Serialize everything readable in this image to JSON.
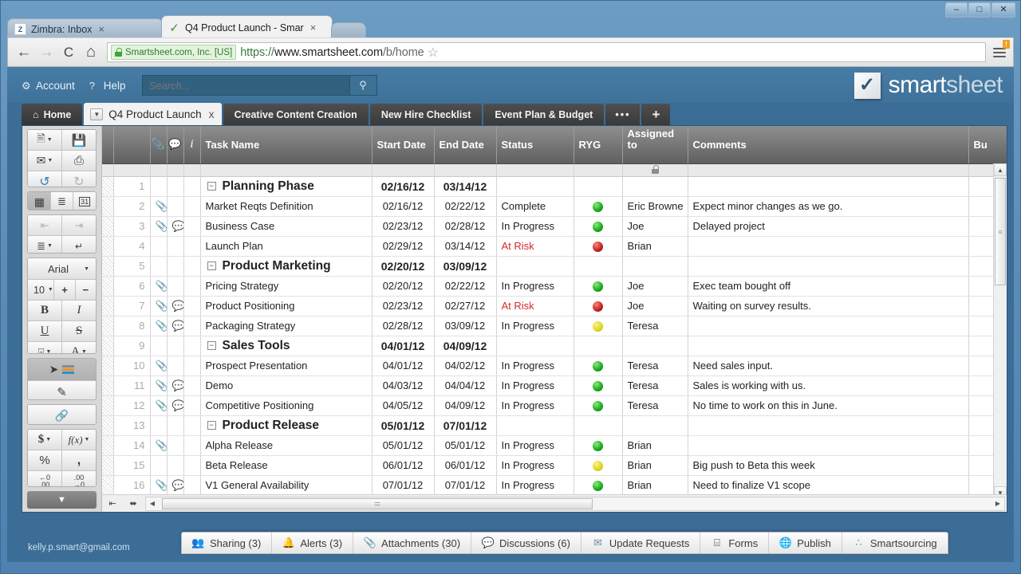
{
  "browser": {
    "window_buttons": {
      "minimize": "–",
      "maximize": "□",
      "close": "✕"
    },
    "tabs": [
      {
        "title": "Zimbra: Inbox",
        "favicon": "zimbra-icon",
        "favicon_text": "Z",
        "active": false,
        "close": "×"
      },
      {
        "title": "Q4 Product Launch - Smar",
        "favicon": "checkmark-icon",
        "favicon_text": "✓",
        "active": true,
        "close": "×"
      }
    ],
    "nav": {
      "back": "←",
      "forward": "→",
      "reload": "C",
      "home": "⌂"
    },
    "security_label": "Smartsheet.com, Inc. [US]",
    "url_scheme": "https://",
    "url_host": "www.smartsheet.com",
    "url_path": "/b/home",
    "bookmark_star": "☆",
    "menu_badge": "!"
  },
  "app_header": {
    "account_label": "Account",
    "help_label": "Help",
    "help_icon_text": "?",
    "search_placeholder": "Search...",
    "search_value": "",
    "search_icon": "⚲",
    "logo_check": "✓",
    "logo_word1": "smart",
    "logo_word2": "sheet"
  },
  "sheet_tabs": {
    "home_label": "Home",
    "home_icon": "⌂",
    "items": [
      {
        "label": "Q4 Product Launch",
        "active": true,
        "caret": "▼",
        "close": "x"
      },
      {
        "label": "Creative Content Creation",
        "active": false
      },
      {
        "label": "New Hire Checklist",
        "active": false
      },
      {
        "label": "Event Plan & Budget",
        "active": false
      }
    ],
    "more_label": "•••",
    "add_label": "+"
  },
  "toolbar": {
    "groups": [
      {
        "rows": [
          [
            {
              "name": "new-row-button",
              "glyph": "⬜",
              "caret": true
            },
            {
              "name": "save-button",
              "glyph": "💾"
            }
          ],
          [
            {
              "name": "send-email-button",
              "glyph": "✉",
              "caret": true
            },
            {
              "name": "print-button",
              "glyph": "⎙"
            }
          ],
          [
            {
              "name": "undo-button",
              "glyph": "↺"
            },
            {
              "name": "redo-button",
              "glyph": "↻",
              "dim": true
            }
          ]
        ]
      },
      {
        "rows": [
          [
            {
              "name": "grid-view-button",
              "glyph": "∷",
              "pressed": true
            },
            {
              "name": "gantt-view-button",
              "glyph": "≡"
            },
            {
              "name": "calendar-view-button",
              "glyph": "31"
            }
          ]
        ]
      },
      {
        "rows": [
          [
            {
              "name": "outdent-button",
              "glyph": "⇤",
              "dim": true
            },
            {
              "name": "indent-button",
              "glyph": "⇥",
              "dim": true
            }
          ],
          [
            {
              "name": "align-button",
              "glyph": "≡",
              "caret": true
            },
            {
              "name": "wrap-text-button",
              "glyph": "↵"
            }
          ]
        ]
      },
      {
        "rows": [
          [
            {
              "name": "font-family-select",
              "font": true,
              "label": "Arial",
              "caret": true
            }
          ],
          [
            {
              "name": "font-size-select",
              "size": true,
              "label": "10",
              "caret": true
            },
            {
              "name": "increase-font-button",
              "glyph": "＋"
            },
            {
              "name": "decrease-font-button",
              "glyph": "－"
            }
          ],
          [
            {
              "name": "bold-button",
              "glyph": "B",
              "cls": "bb"
            },
            {
              "name": "italic-button",
              "glyph": "I",
              "cls": "ii"
            }
          ],
          [
            {
              "name": "underline-button",
              "glyph": "U",
              "cls": "uu"
            },
            {
              "name": "strikethrough-button",
              "glyph": "S",
              "cls": "ss"
            }
          ],
          [
            {
              "name": "fill-color-button",
              "glyph": "🖌",
              "caret": true,
              "swatch": "#f6ef72"
            },
            {
              "name": "font-color-button",
              "glyph": "A",
              "caret": true,
              "swatch": "#cc2222"
            }
          ]
        ]
      },
      {
        "rows": [
          [
            {
              "name": "conditional-formatting-button",
              "glyph": "◈",
              "bars": true,
              "pressed": true
            }
          ],
          [
            {
              "name": "highlight-button",
              "glyph": "✎"
            }
          ]
        ]
      },
      {
        "rows": [
          [
            {
              "name": "hyperlink-button",
              "glyph": "🔗"
            }
          ]
        ]
      },
      {
        "rows": [
          [
            {
              "name": "currency-button",
              "glyph": "$",
              "cls": "dollar",
              "caret": true
            },
            {
              "name": "formula-button",
              "glyph": "f(x)",
              "cls": "fx",
              "caret": true
            }
          ],
          [
            {
              "name": "percent-button",
              "glyph": "%"
            },
            {
              "name": "thousands-separator-button",
              "glyph": ","
            }
          ],
          [
            {
              "name": "decrease-decimal-button",
              "glyph": "←0\n.00",
              "dec": true,
              "line1": "←0",
              "line2": ".00"
            },
            {
              "name": "increase-decimal-button",
              "glyph": ".00→0",
              "dec": true,
              "line1": ".00",
              "line2": "→0"
            }
          ]
        ]
      }
    ],
    "collapse_toolbar_label": "▼"
  },
  "grid": {
    "columns": [
      {
        "key": "hatch",
        "label": ""
      },
      {
        "key": "rownum",
        "label": ""
      },
      {
        "key": "attach",
        "label": "📎",
        "icon": true
      },
      {
        "key": "comment",
        "label": "💬",
        "icon": true
      },
      {
        "key": "info",
        "label": "i",
        "icon": true
      },
      {
        "key": "task",
        "label": "Task Name"
      },
      {
        "key": "start",
        "label": "Start Date"
      },
      {
        "key": "end",
        "label": "End Date"
      },
      {
        "key": "status",
        "label": "Status"
      },
      {
        "key": "ryg",
        "label": "RYG"
      },
      {
        "key": "assigned",
        "label": "Assigned to",
        "locked": true
      },
      {
        "key": "comments",
        "label": "Comments"
      },
      {
        "key": "budget",
        "label": "Bu"
      }
    ],
    "rows": [
      {
        "num": "1",
        "parent": true,
        "collapse": "−",
        "task": "Planning Phase",
        "start": "02/16/12",
        "end": "03/14/12",
        "status": "",
        "ryg": "",
        "assigned": "",
        "comments": "",
        "attach": false,
        "comment": false
      },
      {
        "num": "2",
        "parent": false,
        "task": "Market Reqts Definition",
        "start": "02/16/12",
        "end": "02/22/12",
        "status": "Complete",
        "ryg": "green",
        "assigned": "Eric Browne",
        "comments": "Expect minor changes as we go.",
        "attach": true,
        "comment": false
      },
      {
        "num": "3",
        "parent": false,
        "task": "Business Case",
        "start": "02/23/12",
        "end": "02/28/12",
        "status": "In Progress",
        "ryg": "green",
        "assigned": "Joe",
        "comments": "Delayed project",
        "attach": true,
        "comment": true
      },
      {
        "num": "4",
        "parent": false,
        "task": "Launch Plan",
        "start": "02/29/12",
        "end": "03/14/12",
        "status": "At Risk",
        "ryg": "red",
        "assigned": "Brian",
        "comments": "",
        "attach": false,
        "comment": false
      },
      {
        "num": "5",
        "parent": true,
        "collapse": "−",
        "task": "Product Marketing",
        "start": "02/20/12",
        "end": "03/09/12",
        "status": "",
        "ryg": "",
        "assigned": "",
        "comments": "",
        "attach": false,
        "comment": false
      },
      {
        "num": "6",
        "parent": false,
        "task": "Pricing Strategy",
        "start": "02/20/12",
        "end": "02/22/12",
        "status": "In Progress",
        "ryg": "green",
        "assigned": "Joe",
        "comments": "Exec team bought off",
        "attach": true,
        "comment": false
      },
      {
        "num": "7",
        "parent": false,
        "task": "Product Positioning",
        "start": "02/23/12",
        "end": "02/27/12",
        "status": "At Risk",
        "ryg": "red",
        "assigned": "Joe",
        "comments": "Waiting on survey results.",
        "attach": true,
        "comment": true
      },
      {
        "num": "8",
        "parent": false,
        "task": "Packaging Strategy",
        "start": "02/28/12",
        "end": "03/09/12",
        "status": "In Progress",
        "ryg": "yellow",
        "assigned": "Teresa",
        "comments": "",
        "attach": true,
        "comment": true
      },
      {
        "num": "9",
        "parent": true,
        "collapse": "−",
        "task": "Sales Tools",
        "start": "04/01/12",
        "end": "04/09/12",
        "status": "",
        "ryg": "",
        "assigned": "",
        "comments": "",
        "attach": false,
        "comment": false
      },
      {
        "num": "10",
        "parent": false,
        "task": "Prospect Presentation",
        "start": "04/01/12",
        "end": "04/02/12",
        "status": "In Progress",
        "ryg": "green",
        "assigned": "Teresa",
        "comments": "Need sales input.",
        "attach": true,
        "comment": false
      },
      {
        "num": "11",
        "parent": false,
        "task": "Demo",
        "start": "04/03/12",
        "end": "04/04/12",
        "status": "In Progress",
        "ryg": "green",
        "assigned": "Teresa",
        "comments": "Sales is working with us.",
        "attach": true,
        "comment": true
      },
      {
        "num": "12",
        "parent": false,
        "task": "Competitive Positioning",
        "start": "04/05/12",
        "end": "04/09/12",
        "status": "In Progress",
        "ryg": "green",
        "assigned": "Teresa",
        "comments": "No time to work on this in June.",
        "attach": true,
        "comment": true
      },
      {
        "num": "13",
        "parent": true,
        "collapse": "−",
        "task": "Product Release",
        "start": "05/01/12",
        "end": "07/01/12",
        "status": "",
        "ryg": "",
        "assigned": "",
        "comments": "",
        "attach": false,
        "comment": false
      },
      {
        "num": "14",
        "parent": false,
        "task": "Alpha Release",
        "start": "05/01/12",
        "end": "05/01/12",
        "status": "In Progress",
        "ryg": "green",
        "assigned": "Brian",
        "comments": "",
        "attach": true,
        "comment": false
      },
      {
        "num": "15",
        "parent": false,
        "task": "Beta Release",
        "start": "06/01/12",
        "end": "06/01/12",
        "status": "In Progress",
        "ryg": "yellow",
        "assigned": "Brian",
        "comments": "Big push to Beta this week",
        "attach": false,
        "comment": false
      },
      {
        "num": "16",
        "parent": false,
        "task": "V1 General Availability",
        "start": "07/01/12",
        "end": "07/01/12",
        "status": "In Progress",
        "ryg": "green",
        "assigned": "Brian",
        "comments": "Need to finalize V1 scope",
        "attach": true,
        "comment": true
      }
    ]
  },
  "sheet_footer": {
    "collapse_all_icon": "⇤",
    "expand_icon": "⬌",
    "left_arrow": "◀",
    "right_arrow": "▶",
    "up_arrow": "▲",
    "down_arrow": "▼"
  },
  "action_bar": {
    "items": [
      {
        "name": "sharing-button",
        "icon": "people-icon",
        "glyph": "👥",
        "label": "Sharing (3)"
      },
      {
        "name": "alerts-button",
        "icon": "bell-icon",
        "glyph": "🔔",
        "label": "Alerts (3)"
      },
      {
        "name": "attachments-button",
        "icon": "paperclip-icon",
        "glyph": "📎",
        "label": "Attachments (30)"
      },
      {
        "name": "discussions-button",
        "icon": "speech-bubble-icon",
        "glyph": "💬",
        "label": "Discussions (6)"
      },
      {
        "name": "update-requests-button",
        "icon": "envelope-icon",
        "glyph": "✉",
        "label": "Update Requests"
      },
      {
        "name": "forms-button",
        "icon": "form-icon",
        "glyph": "⌸",
        "label": "Forms"
      },
      {
        "name": "publish-button",
        "icon": "globe-icon",
        "glyph": "🌐",
        "label": "Publish"
      },
      {
        "name": "smartsourcing-button",
        "icon": "network-icon",
        "glyph": "∴",
        "label": "Smartsourcing"
      }
    ]
  },
  "status_bar": {
    "user_email": "kelly.p.smart@gmail.com"
  }
}
